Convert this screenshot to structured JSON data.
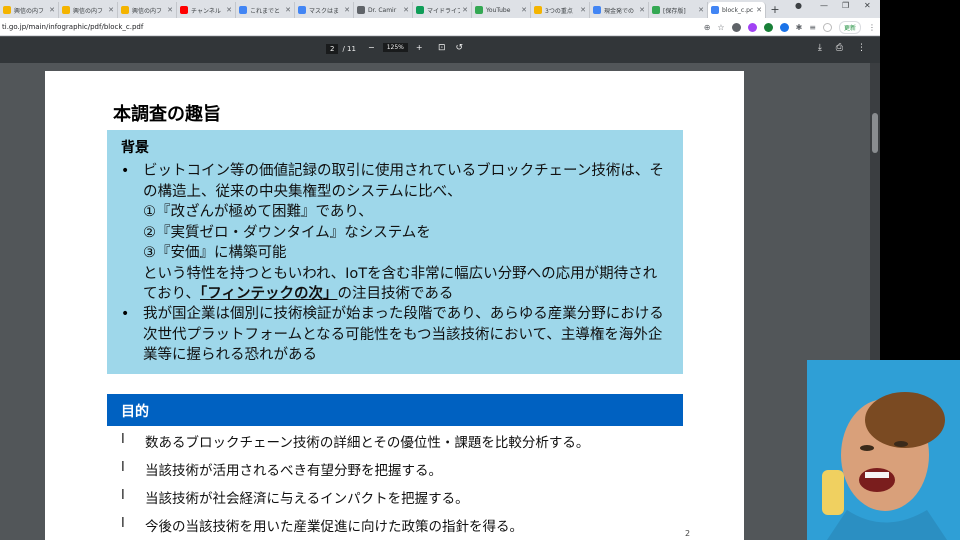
{
  "tabs": [
    {
      "label": "興信の内フ",
      "color": "#f4b400"
    },
    {
      "label": "興信の内フ",
      "color": "#f4b400"
    },
    {
      "label": "興信の内フ",
      "color": "#f4b400"
    },
    {
      "label": "チャンネル",
      "color": "#ff0000"
    },
    {
      "label": "これまでと",
      "color": "#4285f4"
    },
    {
      "label": "マスクはま",
      "color": "#4285f4"
    },
    {
      "label": "Dr. Camir",
      "color": "#5f6368"
    },
    {
      "label": "マイドライブ",
      "color": "#0f9d58"
    },
    {
      "label": "YouTube",
      "color": "#34a853"
    },
    {
      "label": "3つの重点",
      "color": "#f4b400"
    },
    {
      "label": "現金発での",
      "color": "#4285f4"
    },
    {
      "label": "[保存版]",
      "color": "#34a853"
    },
    {
      "label": "block_c.pc",
      "color": "#4285f4"
    }
  ],
  "url": "ti.go.jp/main/infographic/pdf/block_c.pdf",
  "update_label": "更新",
  "pdf": {
    "page_current": "2",
    "page_total": "/ 11",
    "zoom": "125%",
    "page_number": "2"
  },
  "doc": {
    "heading": "本調査の趣旨",
    "background_title": "背景",
    "bullet1_a": "ビットコイン等の価値記録の取引に使用されているブロックチェーン技術は、その構造上、従来の中央集権型のシステムに比べ、",
    "line1": "①『改ざんが極めて困難』であり、",
    "line2": "②『実質ゼロ・ダウンタイム』なシステムを",
    "line3": "③『安価』に構築可能",
    "bullet1_b": "という特性を持つともいわれ、IoTを含む非常に幅広い分野への応用が期待されており、",
    "bullet1_emph": "「フィンテックの次」",
    "bullet1_c": "の注目技術である",
    "bullet2": "我が国企業は個別に技術検証が始まった段階であり、あらゆる産業分野における次世代プラットフォームとなる可能性をもつ当該技術において、主導権を海外企業等に握られる恐れがある",
    "purpose_title": "目的",
    "purpose_mark": "l",
    "purposes": [
      "数あるブロックチェーン技術の詳細とその優位性・課題を比較分析する。",
      "当該技術が活用されるべき有望分野を把握する。",
      "当該技術が社会経済に与えるインパクトを把握する。",
      "今後の当該技術を用いた産業促進に向けた政策の指針を得る。"
    ]
  }
}
